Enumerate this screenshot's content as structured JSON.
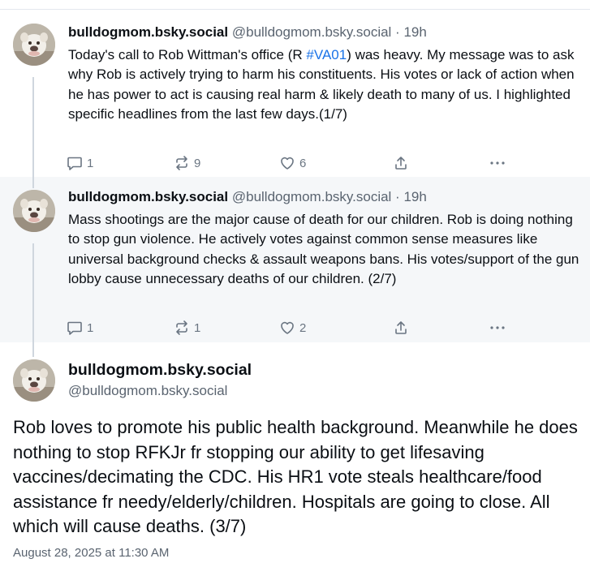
{
  "posts": [
    {
      "author_name": "bulldogmom.bsky.social",
      "author_handle": "@bulldogmom.bsky.social",
      "time_ago": "19h",
      "text_before_tag": "Today's call to Rob Wittman's office (R ",
      "hashtag": "#VA01",
      "text_after_tag": ") was heavy. My message was to ask why Rob is actively trying to harm his constituents. His votes or lack of action when he has power to act is causing real harm & likely death to many of us. I highlighted specific headlines from the last few days.(1/7)",
      "reply_count": "1",
      "repost_count": "9",
      "like_count": "6"
    },
    {
      "author_name": "bulldogmom.bsky.social",
      "author_handle": "@bulldogmom.bsky.social",
      "time_ago": "19h",
      "text": "Mass shootings are the major cause of death for our children. Rob is doing nothing to stop gun violence. He actively votes against common sense measures like universal background checks & assault weapons bans. His votes/support of the gun lobby cause unnecessary deaths of our children. (2/7)",
      "reply_count": "1",
      "repost_count": "1",
      "like_count": "2"
    }
  ],
  "focused_post": {
    "author_name": "bulldogmom.bsky.social",
    "author_handle": "@bulldogmom.bsky.social",
    "text": "Rob loves to promote his public health background. Meanwhile he does nothing to stop RFKJr fr stopping our ability to get lifesaving vaccines/decimating the CDC. His HR1 vote steals healthcare/food assistance fr needy/elderly/children. Hospitals are going to close. All which will cause deaths. (3/7)",
    "timestamp": "August 28, 2025 at 11:30 AM"
  },
  "ui": {
    "separator": " · ",
    "accent_color": "#1a73e8",
    "icon_color": "#6a7582"
  }
}
